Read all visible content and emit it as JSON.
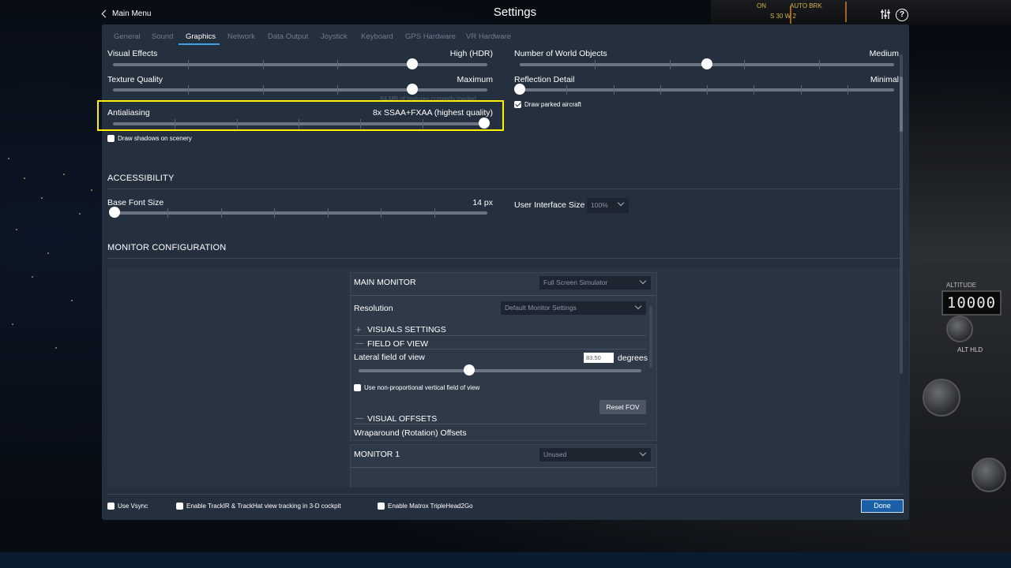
{
  "header": {
    "title": "Settings",
    "back_label": "Main Menu"
  },
  "tabs": [
    {
      "label": "General"
    },
    {
      "label": "Sound"
    },
    {
      "label": "Graphics",
      "active": true
    },
    {
      "label": "Network"
    },
    {
      "label": "Data Output"
    },
    {
      "label": "Joystick"
    },
    {
      "label": "Keyboard"
    },
    {
      "label": "GPS Hardware"
    },
    {
      "label": "VR Hardware"
    }
  ],
  "graphics": {
    "visual_effects": {
      "label": "Visual Effects",
      "value": "High (HDR)",
      "level": 0.8
    },
    "texture_quality": {
      "label": "Texture Quality",
      "value": "Maximum",
      "level": 0.8,
      "hint": "84 MB of textures currently loaded"
    },
    "antialiasing": {
      "label": "Antialiasing",
      "value": "8x SSAA+FXAA (highest quality)",
      "level": 1.0
    },
    "draw_shadows": {
      "label": "Draw shadows on scenery",
      "checked": false
    },
    "world_objects": {
      "label": "Number of World Objects",
      "value": "Medium",
      "level": 0.5
    },
    "reflection_detail": {
      "label": "Reflection Detail",
      "value": "Minimal",
      "level": 0.0
    },
    "draw_parked": {
      "label": "Draw parked aircraft",
      "checked": true
    }
  },
  "accessibility": {
    "title": "ACCESSIBILITY",
    "base_font": {
      "label": "Base Font Size",
      "value": "14 px",
      "level": 0.0
    },
    "ui_size": {
      "label": "User Interface Size",
      "value": "100%"
    }
  },
  "monitor_config": {
    "title": "MONITOR CONFIGURATION",
    "main": {
      "title": "MAIN MONITOR",
      "mode": "Full Screen Simulator",
      "resolution_label": "Resolution",
      "resolution": "Default Monitor Settings",
      "visuals_settings": "VISUALS SETTINGS",
      "fov_title": "FIELD OF VIEW",
      "lateral_label": "Lateral field of view",
      "lateral_value": "83.50",
      "lateral_unit": "degrees",
      "lateral_level": 0.39,
      "nonprop_label": "Use non-proportional vertical field of view",
      "reset_fov": "Reset FOV",
      "offsets_title": "VISUAL OFFSETS",
      "wraparound": "Wraparound (Rotation) Offsets",
      "plus": "+",
      "minus": "—"
    },
    "monitor1": {
      "title": "MONITOR 1",
      "mode": "Unused"
    }
  },
  "footer": {
    "vsync": "Use Vsync",
    "trackir": "Enable TrackIR & TrackHat view tracking in 3-D cockpit",
    "matrox": "Enable Matrox TripleHead2Go",
    "done": "Done"
  },
  "background": {
    "altitude_label": "ALTITUDE",
    "altitude_value": "10000",
    "alt_hld": "ALT HLD"
  },
  "colors": {
    "accent": "#3fa0e8",
    "highlight": "#ffef00",
    "panel": "#25303e",
    "done_button": "#1a5fa8"
  }
}
